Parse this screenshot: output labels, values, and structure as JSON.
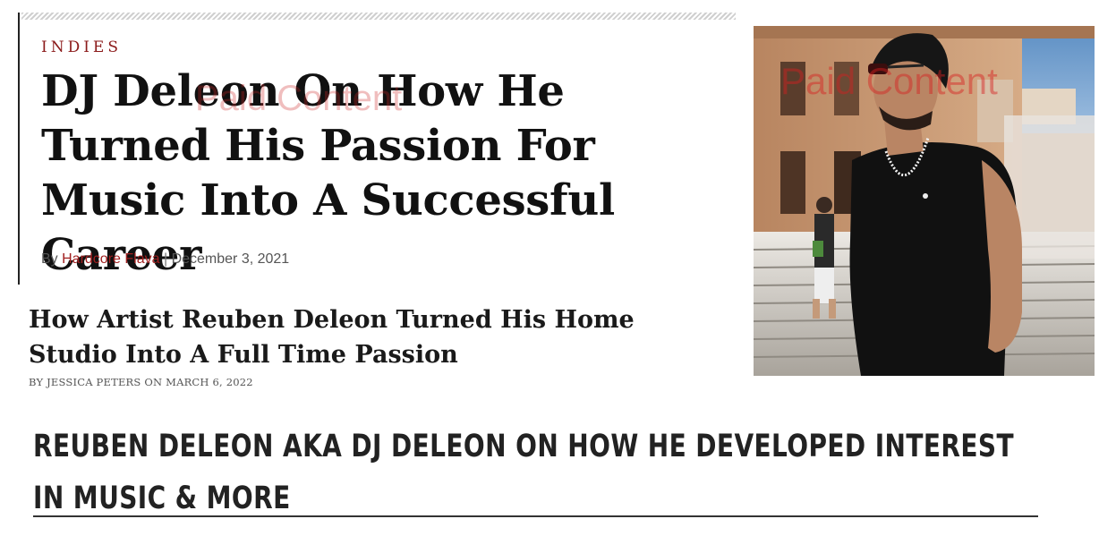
{
  "article": {
    "category": "INDIES",
    "headline": "DJ Deleon On How He Turned His Passion For Music Into A Successful Career",
    "byline_prefix": "By",
    "author": "Hardcore Flava",
    "separator": "|",
    "date": "December 3, 2021",
    "watermark": "Paid Content"
  },
  "secondary_article": {
    "headline": "How Artist Reuben Deleon Turned His Home Studio Into A Full Time Passion",
    "byline": "BY JESSICA PETERS ON MARCH 6, 2022"
  },
  "photo": {
    "watermark": "Paid Content",
    "colors": {
      "shirt": "#111111",
      "building": "#c79a74",
      "sky": "#6f9fcf",
      "stairs": "#d9d6d0"
    }
  },
  "feature": {
    "heading": "REUBEN DELEON AKA DJ DELEON ON HOW HE DEVELOPED INTEREST IN MUSIC & MORE"
  },
  "colors": {
    "accent": "#a11f1f",
    "text": "#111111",
    "watermark": "#cd2828"
  }
}
